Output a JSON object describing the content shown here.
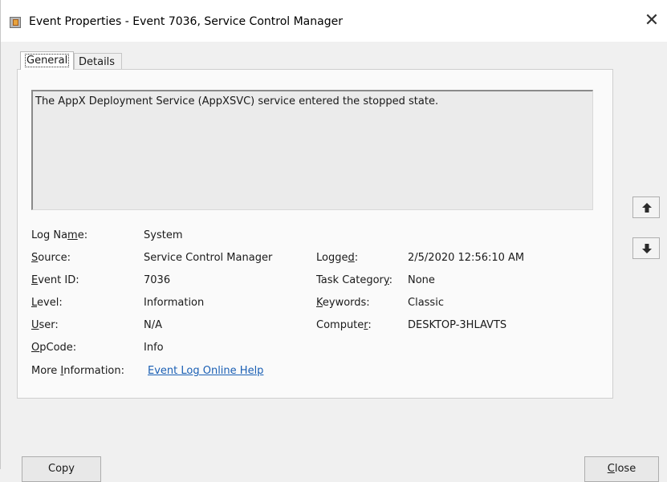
{
  "window": {
    "title": "Event Properties - Event 7036, Service Control Manager",
    "close_glyph": "✕"
  },
  "tabs": [
    {
      "label": "General",
      "selected": true
    },
    {
      "label": "Details",
      "selected": false
    }
  ],
  "general": {
    "description": "The AppX Deployment Service (AppXSVC) service entered the stopped state.",
    "fields_left": [
      {
        "label": "Log Name:",
        "value": "System"
      },
      {
        "label": "Source:",
        "value": "Service Control Manager"
      },
      {
        "label": "Event ID:",
        "value": "7036"
      },
      {
        "label": "Level:",
        "value": "Information"
      },
      {
        "label": "User:",
        "value": "N/A"
      },
      {
        "label": "OpCode:",
        "value": "Info"
      }
    ],
    "fields_right": [
      {
        "label": "Logged:",
        "value": "2/5/2020 12:56:10 AM"
      },
      {
        "label": "Task Category:",
        "value": "None"
      },
      {
        "label": "Keywords:",
        "value": "Classic"
      },
      {
        "label": "Computer:",
        "value": "DESKTOP-3HLAVTS"
      }
    ],
    "more_info_label": "More Information:",
    "more_info_link": "Event Log Online Help"
  },
  "nav": {
    "up_icon": "arrow-up-icon",
    "down_icon": "arrow-down-icon"
  },
  "buttons": {
    "copy": "Copy",
    "close": "Close"
  },
  "colors": {
    "link": "#1a5fb4",
    "background": "#f0f0f0"
  }
}
